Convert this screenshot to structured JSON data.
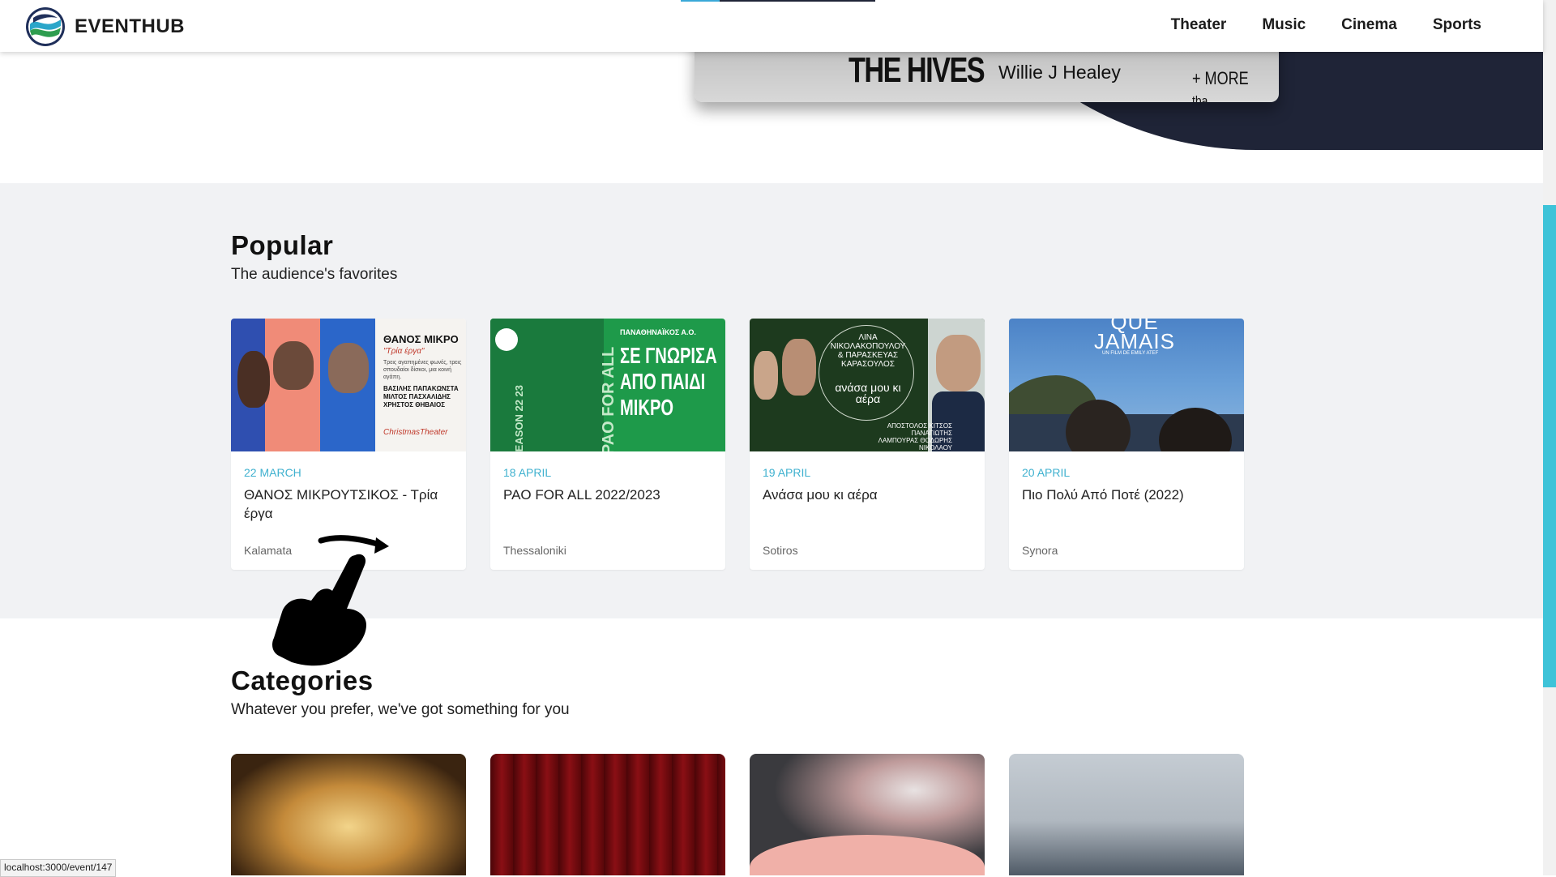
{
  "nav": {
    "brand": "EVENTHUB",
    "links": [
      "Theater",
      "Music",
      "Cinema",
      "Sports"
    ]
  },
  "hero": {
    "poster_band": "THE HIVES",
    "poster_artist": "Willie J Healey",
    "poster_more": "+ MORE",
    "poster_tba": "tba"
  },
  "popular": {
    "title": "Popular",
    "subtitle": "The audience's favorites",
    "cards": [
      {
        "date": "22 MARCH",
        "title": "ΘΑΝΟΣ ΜΙΚΡΟΥΤΣΙΚΟΣ - Τρία έργα",
        "location": "Kalamata",
        "poster_title": "ΘΑΝΟΣ ΜΙΚΡΟ",
        "poster_subtitle": "\"Τρία έργα\"",
        "poster_blurb": "Τρεις αγαπημένες φωνές, τρεις σπουδαίοι δίσκοι, μια κοινή αγάπη.",
        "poster_cast": "ΒΑΣΙΛΗΣ ΠΑΠΑΚΩΝΣΤΑ ΜΙΛΤΟΣ ΠΑΣΧΑΛΙΔΗΣ ΧΡΗΣΤΟΣ ΘΗΒΑΙΟΣ",
        "poster_venue": "ChristmasTheater"
      },
      {
        "date": "18 APRIL",
        "title": "PAO FOR ALL 2022/2023",
        "location": "Thessaloniki",
        "poster_org": "ΠΑΝΑΘΗΝΑΪΚΟΣ Α.Ο.",
        "poster_headline": "ΣΕ ΓΝΩΡΙΣΑ ΑΠΟ ΠΑΙΔΙ ΜΙΚΡΟ",
        "poster_vertical": "PAO FOR ALL",
        "poster_season": "SEASON 22 23"
      },
      {
        "date": "19 APRIL",
        "title": "Ανάσα μου κι αέρα",
        "location": "Sotiros",
        "poster_names": "ΛΙΝΑ ΝΙΚΟΛΑΚΟΠΟΥΛΟΥ & ΠΑΡΑΣΚΕΥΑΣ ΚΑΡΑΣΟΥΛΟΣ",
        "poster_title": "ανάσα μου κι αέρα",
        "poster_credits": "ΑΠΟΣΤΟΛΟΣ ΚΙΤΣΟΣ ΠΑΝΑΓΙΩΤΗΣ ΛΑΜΠΟΥΡΑΣ ΘΟΔΩΡΗΣ ΝΙΚΟΛΑΟΥ"
      },
      {
        "date": "20 APRIL",
        "title": "Πιο Πολύ Από Ποτέ (2022)",
        "location": "Synora",
        "poster_title": "QUE JAMAIS",
        "poster_credit": "UN FILM DE EMILY ATEF"
      }
    ]
  },
  "categories": {
    "title": "Categories",
    "subtitle": "Whatever you prefer, we've got something for you"
  },
  "status_url": "localhost:3000/event/147",
  "colors": {
    "accent": "#3fb1cf",
    "scrollbar": "#3ec3d8",
    "hero_dark": "#1f2437",
    "section_bg": "#f1f2f4"
  }
}
